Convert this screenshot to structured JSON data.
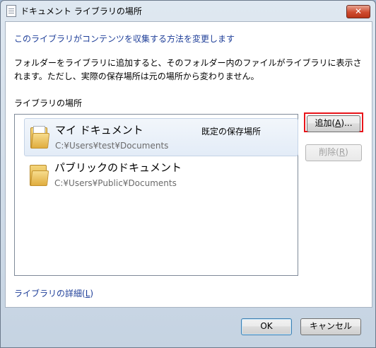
{
  "window": {
    "title": "ドキュメント ライブラリの場所",
    "close_glyph": "✕"
  },
  "main": {
    "heading": "このライブラリがコンテンツを収集する方法を変更します",
    "description": "フォルダーをライブラリに追加すると、そのフォルダー内のファイルがライブラリに表示されます。ただし、実際の保存場所は元の場所から変わりません。",
    "section_label": "ライブラリの場所",
    "locations": [
      {
        "name": "マイ ドキュメント",
        "path": "C:¥Users¥test¥Documents",
        "default_label": "既定の保存場所"
      },
      {
        "name": "パブリックのドキュメント",
        "path": "C:¥Users¥Public¥Documents",
        "default_label": ""
      }
    ],
    "buttons": {
      "add": {
        "label": "追加(",
        "key": "A",
        "suffix": ")..."
      },
      "remove": {
        "label": "削除(",
        "key": "R",
        "suffix": ")"
      }
    },
    "details_link": {
      "label": "ライブラリの詳細(",
      "key": "L",
      "suffix": ")"
    }
  },
  "footer": {
    "ok_label": "OK",
    "cancel_label": "キャンセル"
  }
}
